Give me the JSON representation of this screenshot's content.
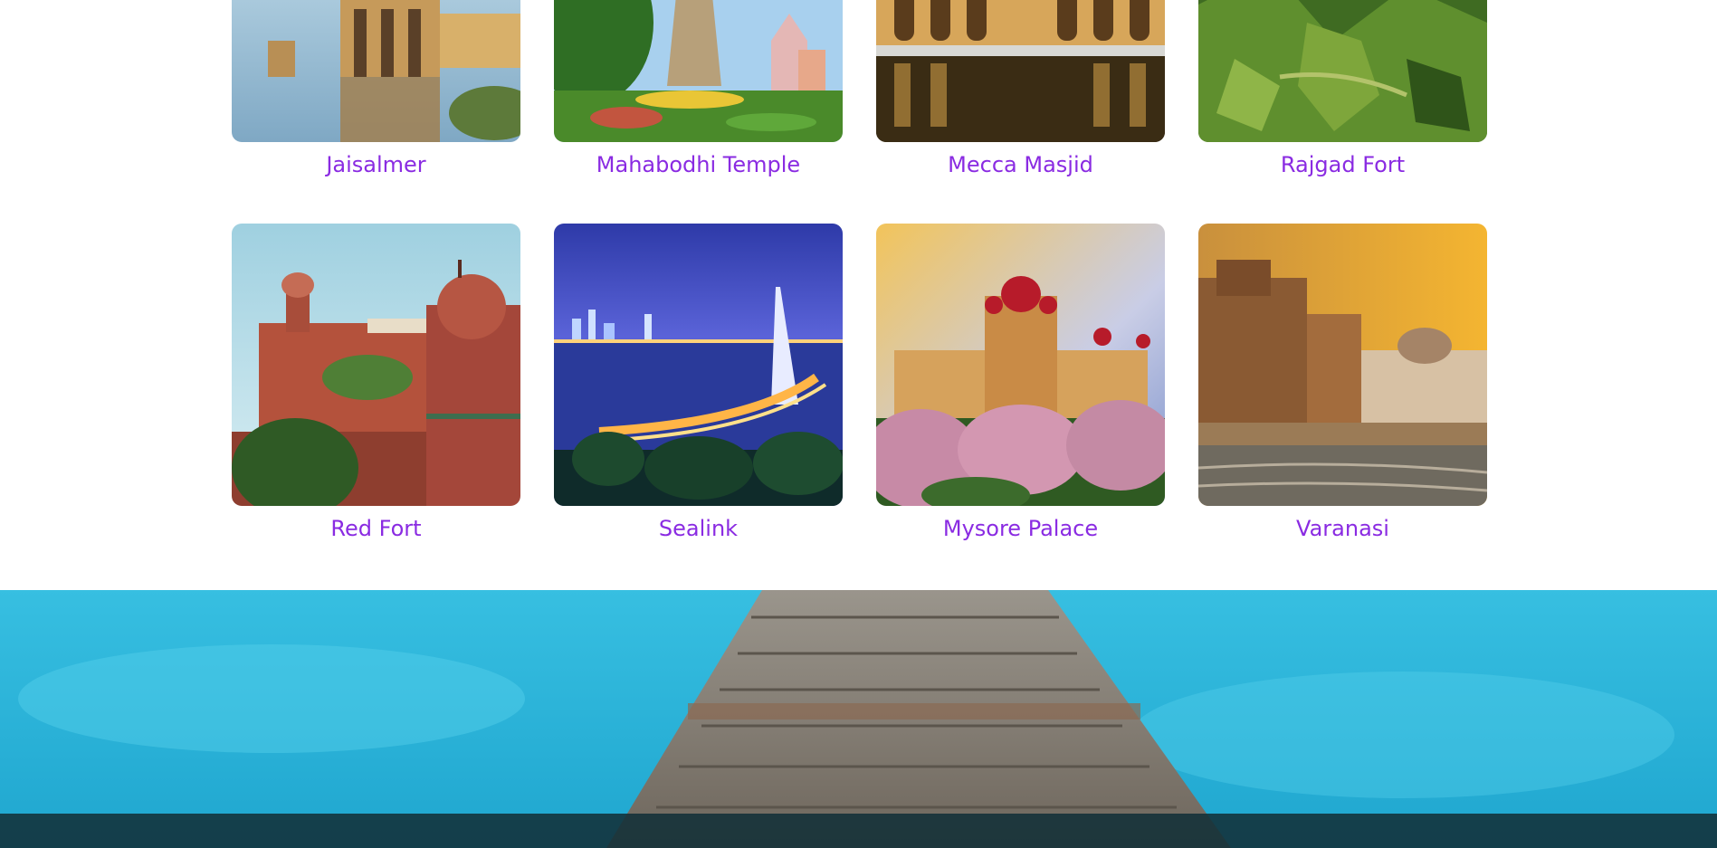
{
  "destinations": [
    {
      "name": "Jaisalmer",
      "image": "lake-palace-reflection"
    },
    {
      "name": "Mahabodhi Temple",
      "image": "temple-garden"
    },
    {
      "name": "Mecca Masjid",
      "image": "palace-reflection-pool"
    },
    {
      "name": "Rajgad Fort",
      "image": "green-mountain"
    },
    {
      "name": "Red Fort",
      "image": "red-sandstone-fort"
    },
    {
      "name": "Sealink",
      "image": "city-bridge-night"
    },
    {
      "name": "Mysore Palace",
      "image": "palace-flowers"
    },
    {
      "name": "Varanasi",
      "image": "river-ghats"
    }
  ],
  "hero": {
    "image": "wooden-pier-over-turquoise-water"
  }
}
